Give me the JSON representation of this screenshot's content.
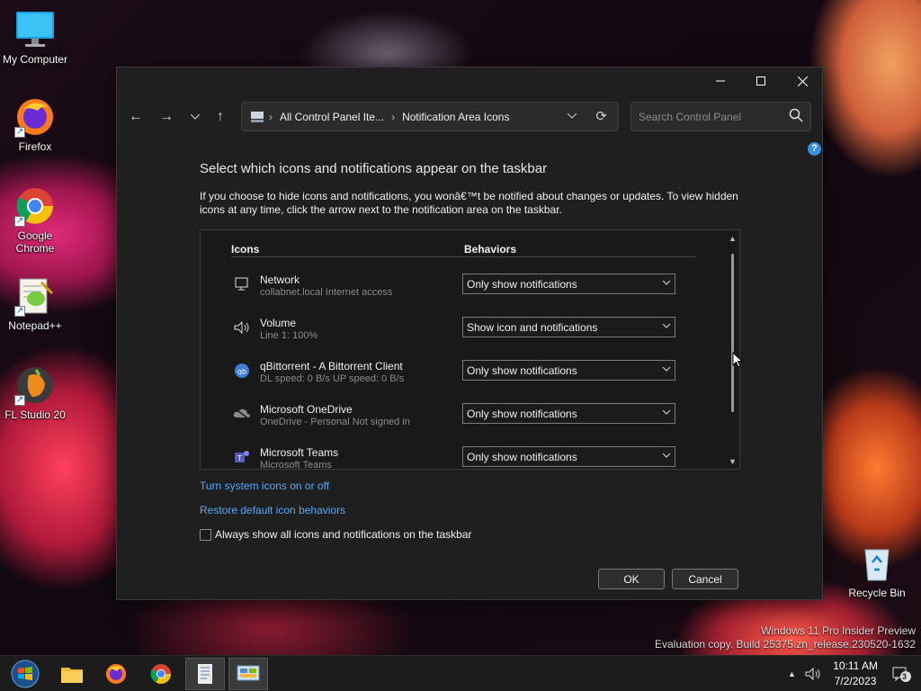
{
  "desktop": {
    "icons": [
      {
        "label": "My Computer"
      },
      {
        "label": "Firefox"
      },
      {
        "label": "Google Chrome"
      },
      {
        "label": "Notepad++"
      },
      {
        "label": "FL Studio 20"
      },
      {
        "label": "Recycle Bin"
      }
    ]
  },
  "window": {
    "titlebar": {
      "minimize": "—",
      "maximize": "☐",
      "close": "✕"
    },
    "nav": {
      "back": "←",
      "forward": "→",
      "recent": "⌄",
      "up": "↑"
    },
    "address": {
      "crumbs": [
        "All Control Panel Ite...",
        "Notification Area Icons"
      ],
      "separator": "›"
    },
    "search": {
      "placeholder": "Search Control Panel"
    },
    "help": "?",
    "title": "Select which icons and notifications appear on the taskbar",
    "description": "If you choose to hide icons and notifications, you wonâ€™t be notified about changes or updates. To view hidden icons at any time, click the arrow next to the notification area on the taskbar.",
    "table": {
      "col_icons": "Icons",
      "col_behaviors": "Behaviors",
      "rows": [
        {
          "name": "Network",
          "sub": "collabnet.local Internet access",
          "behavior": "Only show notifications",
          "icon": "network-icon"
        },
        {
          "name": "Volume",
          "sub": "Line 1: 100%",
          "behavior": "Show icon and notifications",
          "icon": "speaker-icon"
        },
        {
          "name": "qBittorrent - A Bittorrent Client",
          "sub": "DL speed: 0 B/s UP speed: 0 B/s",
          "behavior": "Only show notifications",
          "icon": "qbittorrent-icon"
        },
        {
          "name": "Microsoft OneDrive",
          "sub": "OneDrive - Personal Not signed in",
          "behavior": "Only show notifications",
          "icon": "onedrive-icon"
        },
        {
          "name": "Microsoft Teams",
          "sub": "Microsoft Teams",
          "behavior": "Only show notifications",
          "icon": "teams-icon"
        }
      ]
    },
    "links": {
      "system_icons": "Turn system icons on or off",
      "restore": "Restore default icon behaviors"
    },
    "always_show": "Always show all icons and notifications on the taskbar",
    "ok": "OK",
    "cancel": "Cancel"
  },
  "watermark": {
    "line1": "Windows 11 Pro Insider Preview",
    "line2": "Evaluation copy. Build 25375.zn_release.230520-1632"
  },
  "taskbar": {
    "time": "10:11 AM",
    "date": "7/2/2023",
    "notification_count": "3",
    "tray_arrow": "▲"
  },
  "colors": {
    "accent": "#5aa6f2",
    "window_bg": "#1f1f1f",
    "taskbar_bg": "#1c1c1c"
  }
}
